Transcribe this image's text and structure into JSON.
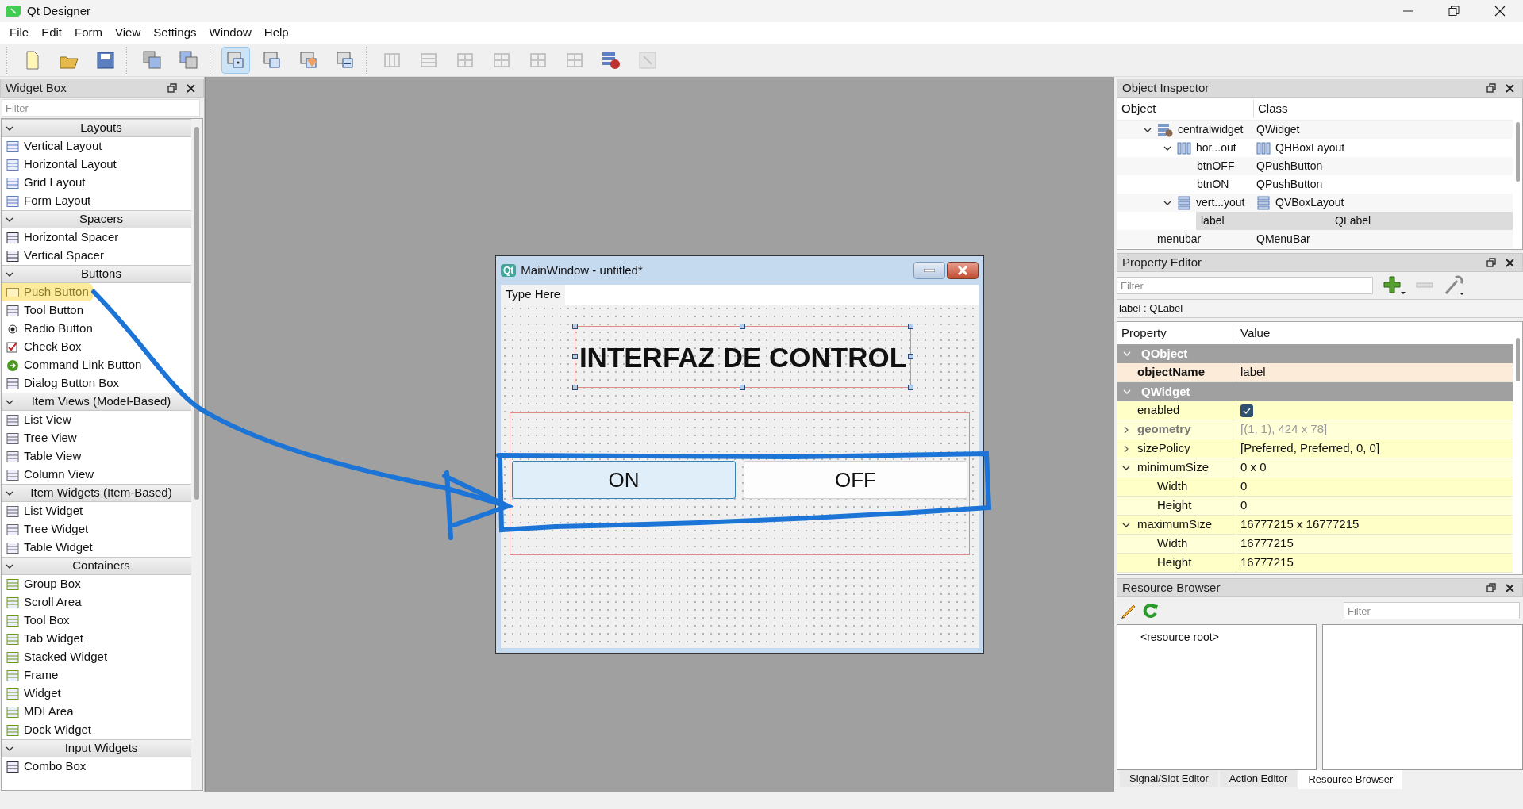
{
  "window": {
    "title": "Qt Designer"
  },
  "menu": [
    "File",
    "Edit",
    "Form",
    "View",
    "Settings",
    "Window",
    "Help"
  ],
  "toolbar": [
    [
      {
        "selected": false,
        "disabled": false
      },
      {
        "selected": false,
        "disabled": false
      },
      {
        "selected": false,
        "disabled": false
      }
    ],
    [
      {
        "selected": false,
        "disabled": false
      },
      {
        "selected": false,
        "disabled": false
      }
    ],
    [
      {
        "selected": true,
        "disabled": false
      },
      {
        "selected": false,
        "disabled": false
      },
      {
        "selected": false,
        "disabled": false
      },
      {
        "selected": false,
        "disabled": false
      }
    ],
    [
      {
        "selected": false,
        "disabled": true
      },
      {
        "selected": false,
        "disabled": true
      },
      {
        "selected": false,
        "disabled": true
      },
      {
        "selected": false,
        "disabled": true
      },
      {
        "selected": false,
        "disabled": true
      },
      {
        "selected": false,
        "disabled": true
      },
      {
        "selected": false,
        "disabled": false
      },
      {
        "selected": false,
        "disabled": true
      }
    ]
  ],
  "widget_box": {
    "title": "Widget Box",
    "filter": {
      "placeholder": "Filter"
    },
    "sections": [
      {
        "title": "Layouts",
        "expanded": true,
        "items": [
          {
            "label": "Vertical Layout",
            "highlighted": false
          },
          {
            "label": "Horizontal Layout",
            "highlighted": false
          },
          {
            "label": "Grid Layout",
            "highlighted": false
          },
          {
            "label": "Form Layout",
            "highlighted": false
          }
        ]
      },
      {
        "title": "Spacers",
        "expanded": true,
        "items": [
          {
            "label": "Horizontal Spacer",
            "highlighted": false
          },
          {
            "label": "Vertical Spacer",
            "highlighted": false
          }
        ]
      },
      {
        "title": "Buttons",
        "expanded": true,
        "items": [
          {
            "label": "Push Button",
            "highlighted": true
          },
          {
            "label": "Tool Button",
            "highlighted": false
          },
          {
            "label": "Radio Button",
            "highlighted": false
          },
          {
            "label": "Check Box",
            "highlighted": false
          },
          {
            "label": "Command Link Button",
            "highlighted": false
          },
          {
            "label": "Dialog Button Box",
            "highlighted": false
          }
        ]
      },
      {
        "title": "Item Views (Model-Based)",
        "expanded": true,
        "items": [
          {
            "label": "List View",
            "highlighted": false
          },
          {
            "label": "Tree View",
            "highlighted": false
          },
          {
            "label": "Table View",
            "highlighted": false
          },
          {
            "label": "Column View",
            "highlighted": false
          }
        ]
      },
      {
        "title": "Item Widgets (Item-Based)",
        "expanded": true,
        "items": [
          {
            "label": "List Widget",
            "highlighted": false
          },
          {
            "label": "Tree Widget",
            "highlighted": false
          },
          {
            "label": "Table Widget",
            "highlighted": false
          }
        ]
      },
      {
        "title": "Containers",
        "expanded": true,
        "items": [
          {
            "label": "Group Box",
            "highlighted": false
          },
          {
            "label": "Scroll Area",
            "highlighted": false
          },
          {
            "label": "Tool Box",
            "highlighted": false
          },
          {
            "label": "Tab Widget",
            "highlighted": false
          },
          {
            "label": "Stacked Widget",
            "highlighted": false
          },
          {
            "label": "Frame",
            "highlighted": false
          },
          {
            "label": "Widget",
            "highlighted": false
          },
          {
            "label": "MDI Area",
            "highlighted": false
          },
          {
            "label": "Dock Widget",
            "highlighted": false
          }
        ]
      },
      {
        "title": "Input Widgets",
        "expanded": true,
        "items": [
          {
            "label": "Combo Box",
            "highlighted": false
          }
        ]
      }
    ]
  },
  "form_window": {
    "logo_text": "Qt",
    "title": "MainWindow - untitled*",
    "menu_placeholder": "Type Here",
    "label": "INTERFAZ DE CONTROL",
    "buttons": [
      {
        "label": "ON",
        "highlighted": true
      },
      {
        "label": "OFF",
        "highlighted": false
      }
    ]
  },
  "object_inspector": {
    "title": "Object Inspector",
    "columns": [
      "Object",
      "Class"
    ],
    "tree": [
      {
        "object": "centralwidget",
        "class": "QWidget",
        "kind": "widget",
        "expanded": true,
        "selected": false,
        "children": [
          {
            "object": "hor...out",
            "class": "QHBoxLayout",
            "kind": "hbox",
            "expanded": true,
            "selected": false,
            "children": [
              {
                "object": "btnOFF",
                "class": "QPushButton",
                "selected": false
              },
              {
                "object": "btnON",
                "class": "QPushButton",
                "selected": false
              }
            ]
          },
          {
            "object": "vert...yout",
            "class": "QVBoxLayout",
            "kind": "vbox",
            "expanded": true,
            "selected": false,
            "children": [
              {
                "object": "label",
                "class": "QLabel",
                "selected": true
              }
            ]
          }
        ]
      },
      {
        "object": "menubar",
        "class": "QMenuBar",
        "selected": false
      }
    ]
  },
  "property_editor": {
    "title": "Property Editor",
    "filter": {
      "placeholder": "Filter"
    },
    "object_label": "label : QLabel",
    "columns": [
      "Property",
      "Value"
    ],
    "groups": [
      {
        "name": "QObject",
        "expanded": true,
        "color": "#fdebd9",
        "properties": [
          {
            "name": "objectName",
            "kind": "text",
            "value": "label",
            "bold": true
          }
        ]
      },
      {
        "name": "QWidget",
        "expanded": true,
        "color": "#ffffc8",
        "properties": [
          {
            "name": "enabled",
            "kind": "checkbox",
            "checked": true
          },
          {
            "name": "geometry",
            "kind": "text",
            "value": "[(1, 1), 424 x 78]",
            "bold": true,
            "disabled": true,
            "expanded": false
          },
          {
            "name": "sizePolicy",
            "kind": "text",
            "value": "[Preferred, Preferred, 0, 0]",
            "expanded": false
          },
          {
            "name": "minimumSize",
            "kind": "text",
            "value": "0 x 0",
            "expanded": true,
            "children": [
              {
                "name": "Width",
                "kind": "text",
                "value": "0"
              },
              {
                "name": "Height",
                "kind": "text",
                "value": "0"
              }
            ]
          },
          {
            "name": "maximumSize",
            "kind": "text",
            "value": "16777215 x 16777215",
            "expanded": true,
            "children": [
              {
                "name": "Width",
                "kind": "text",
                "value": "16777215"
              },
              {
                "name": "Height",
                "kind": "text",
                "value": "16777215"
              }
            ]
          }
        ]
      }
    ]
  },
  "resource_browser": {
    "title": "Resource Browser",
    "filter": {
      "placeholder": "Filter"
    },
    "root": "<resource root>"
  },
  "bottom_tabs": [
    {
      "label": "Signal/Slot Editor",
      "selected": false
    },
    {
      "label": "Action Editor",
      "selected": false
    },
    {
      "label": "Resource Browser",
      "selected": true
    }
  ]
}
